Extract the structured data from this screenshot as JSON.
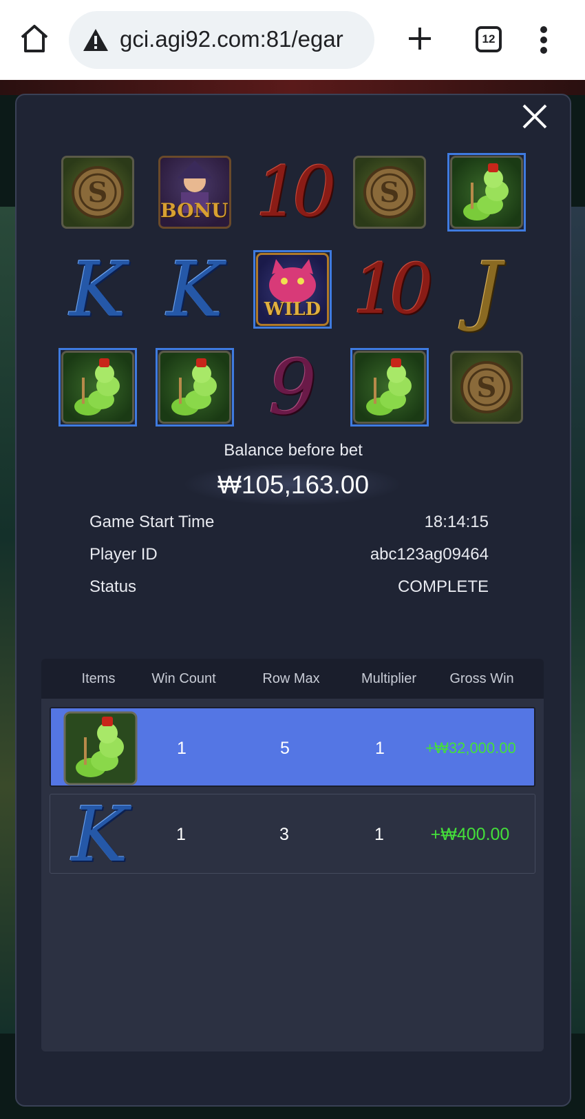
{
  "browser": {
    "url": "gci.agi92.com:81/egar",
    "tab_count": "12",
    "icons": [
      "home-icon",
      "warning-icon",
      "plus-icon",
      "tabs-icon",
      "menu-icon"
    ]
  },
  "reels": {
    "rows": [
      [
        {
          "symbol": "coin",
          "win": false
        },
        {
          "symbol": "bonus",
          "label": "BONUS",
          "win": false
        },
        {
          "symbol": "ten",
          "label": "10",
          "win": false
        },
        {
          "symbol": "coin",
          "win": false
        },
        {
          "symbol": "caterpillar",
          "win": true
        }
      ],
      [
        {
          "symbol": "king",
          "label": "K",
          "win": false
        },
        {
          "symbol": "king",
          "label": "K",
          "win": false
        },
        {
          "symbol": "wild",
          "label": "WILD",
          "win": true
        },
        {
          "symbol": "ten",
          "label": "10",
          "win": false
        },
        {
          "symbol": "jack",
          "label": "J",
          "win": false
        }
      ],
      [
        {
          "symbol": "caterpillar",
          "win": true
        },
        {
          "symbol": "caterpillar",
          "win": true
        },
        {
          "symbol": "nine",
          "label": "9",
          "win": false
        },
        {
          "symbol": "caterpillar",
          "win": true
        },
        {
          "symbol": "coin",
          "win": false
        }
      ]
    ]
  },
  "balance": {
    "label": "Balance before bet",
    "value": "₩105,163.00"
  },
  "info": {
    "start_time_label": "Game Start Time",
    "start_time_value": "18:14:15",
    "player_id_label": "Player ID",
    "player_id_value": "abc123ag09464",
    "status_label": "Status",
    "status_value": "COMPLETE"
  },
  "table": {
    "headers": {
      "items": "Items",
      "win_count": "Win Count",
      "row_max": "Row Max",
      "multiplier": "Multiplier",
      "gross_win": "Gross Win"
    },
    "rows": [
      {
        "item": "caterpillar",
        "win_count": "1",
        "row_max": "5",
        "multiplier": "1",
        "gross_win": "+₩32,000.00",
        "highlighted": true
      },
      {
        "item": "king",
        "item_label": "K",
        "win_count": "1",
        "row_max": "3",
        "multiplier": "1",
        "gross_win": "+₩400.00",
        "highlighted": false
      }
    ]
  },
  "colors": {
    "modal_bg": "#1f2434",
    "highlight_row": "#5476e4",
    "win_border": "#3f7be0",
    "win_text": "#44e03a"
  }
}
